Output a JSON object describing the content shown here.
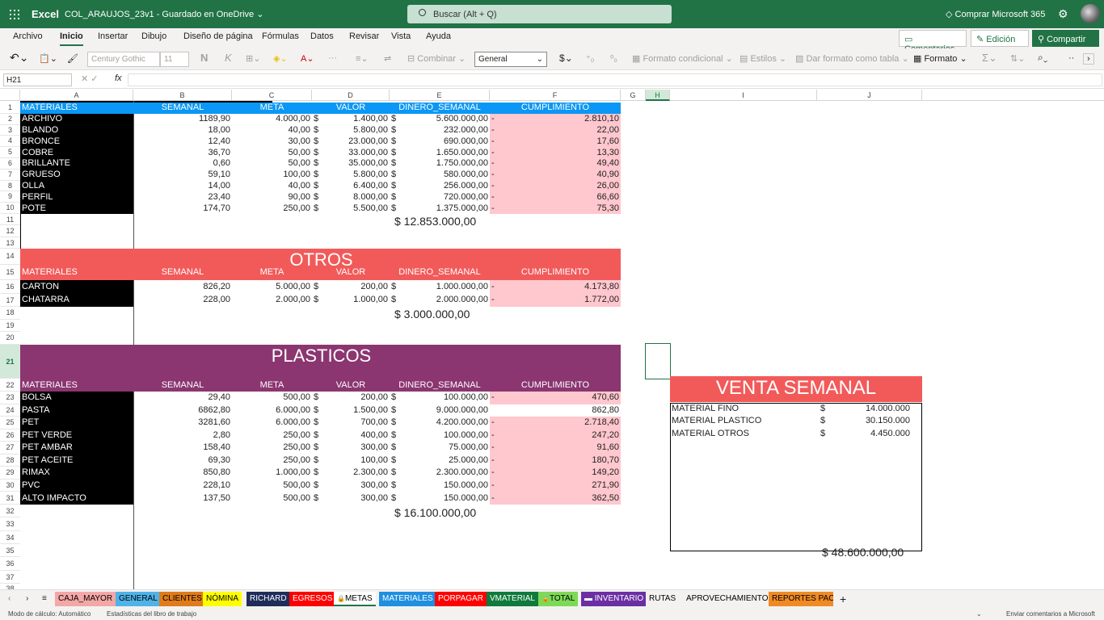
{
  "titlebar": {
    "app": "Excel",
    "doc": "COL_ARAUJOS_23v1 - Guardado en OneDrive ⌄",
    "search": "Buscar (Alt + Q)",
    "buy": "Comprar Microsoft 365",
    "gear": "⚙"
  },
  "menu": [
    "Archivo",
    "Inicio",
    "Insertar",
    "Dibujo",
    "Diseño de página",
    "Fórmulas",
    "Datos",
    "Revisar",
    "Vista",
    "Ayuda"
  ],
  "buttons": {
    "comments": "Comentarios",
    "edit": "Edición",
    "share": "Compartir"
  },
  "ribbon": {
    "font": "Century Gothic",
    "size": "11",
    "bold": "N",
    "italic": "K",
    "combine": "Combinar",
    "format": "General",
    "currency": "$",
    "cond": "Formato condicional",
    "styles": "Estilos",
    "table": "Dar formato como tabla",
    "fmt": "Formato"
  },
  "formula_bar": {
    "namebox": "H21",
    "fx": "fx"
  },
  "columns": [
    "A",
    "B",
    "C",
    "D",
    "E",
    "F",
    "G",
    "H",
    "I",
    "J"
  ],
  "rows": [
    "1",
    "2",
    "3",
    "4",
    "5",
    "6",
    "7",
    "8",
    "9",
    "10",
    "11",
    "12",
    "13",
    "14",
    "15",
    "16",
    "17",
    "18",
    "19",
    "20",
    "21",
    "22",
    "23",
    "24",
    "25",
    "26",
    "27",
    "28",
    "29",
    "30",
    "31",
    "32",
    "33",
    "34",
    "35",
    "36",
    "37",
    "38"
  ],
  "headers": {
    "a": "MATERIALES",
    "b": "SEMANAL",
    "c": "META",
    "d": "VALOR",
    "e": "DINERO_SEMANAL",
    "f": "CUMPLIMIENTO"
  },
  "section1": {
    "rows": [
      {
        "name": "ARCHIVO",
        "sem": "1189,90",
        "meta": "4.000,00",
        "valor": "1.400,00",
        "dinero": "5.600.000,00",
        "cump": "2.810,10"
      },
      {
        "name": "BLANDO",
        "sem": "18,00",
        "meta": "40,00",
        "valor": "5.800,00",
        "dinero": "232.000,00",
        "cump": "22,00"
      },
      {
        "name": "BRONCE",
        "sem": "12,40",
        "meta": "30,00",
        "valor": "23.000,00",
        "dinero": "690.000,00",
        "cump": "17,60"
      },
      {
        "name": "COBRE",
        "sem": "36,70",
        "meta": "50,00",
        "valor": "33.000,00",
        "dinero": "1.650.000,00",
        "cump": "13,30"
      },
      {
        "name": "BRILLANTE",
        "sem": "0,60",
        "meta": "50,00",
        "valor": "35.000,00",
        "dinero": "1.750.000,00",
        "cump": "49,40"
      },
      {
        "name": "GRUESO",
        "sem": "59,10",
        "meta": "100,00",
        "valor": "5.800,00",
        "dinero": "580.000,00",
        "cump": "40,90"
      },
      {
        "name": "OLLA",
        "sem": "14,00",
        "meta": "40,00",
        "valor": "6.400,00",
        "dinero": "256.000,00",
        "cump": "26,00"
      },
      {
        "name": "PERFIL",
        "sem": "23,40",
        "meta": "90,00",
        "valor": "8.000,00",
        "dinero": "720.000,00",
        "cump": "66,60"
      },
      {
        "name": "POTE",
        "sem": "174,70",
        "meta": "250,00",
        "valor": "5.500,00",
        "dinero": "1.375.000,00",
        "cump": "75,30"
      }
    ],
    "total": "$ 12.853.000,00"
  },
  "section2": {
    "title": "OTROS",
    "rows": [
      {
        "name": "CARTON",
        "sem": "826,20",
        "meta": "5.000,00",
        "valor": "200,00",
        "dinero": "1.000.000,00",
        "cump": "4.173,80"
      },
      {
        "name": "CHATARRA",
        "sem": "228,00",
        "meta": "2.000,00",
        "valor": "1.000,00",
        "dinero": "2.000.000,00",
        "cump": "1.772,00"
      }
    ],
    "total": "$  3.000.000,00"
  },
  "section3": {
    "title": "PLASTICOS",
    "rows": [
      {
        "name": "BOLSA",
        "sem": "29,40",
        "meta": "500,00",
        "valor": "200,00",
        "dinero": "100.000,00",
        "cump": "470,60",
        "neg": true
      },
      {
        "name": "PASTA",
        "sem": "6862,80",
        "meta": "6.000,00",
        "valor": "1.500,00",
        "dinero": "9.000.000,00",
        "cump": "862,80",
        "neg": false
      },
      {
        "name": "PET",
        "sem": "3281,60",
        "meta": "6.000,00",
        "valor": "700,00",
        "dinero": "4.200.000,00",
        "cump": "2.718,40",
        "neg": true
      },
      {
        "name": "PET VERDE",
        "sem": "2,80",
        "meta": "250,00",
        "valor": "400,00",
        "dinero": "100.000,00",
        "cump": "247,20",
        "neg": true
      },
      {
        "name": "PET AMBAR",
        "sem": "158,40",
        "meta": "250,00",
        "valor": "300,00",
        "dinero": "75.000,00",
        "cump": "91,60",
        "neg": true
      },
      {
        "name": "PET ACEITE",
        "sem": "69,30",
        "meta": "250,00",
        "valor": "100,00",
        "dinero": "25.000,00",
        "cump": "180,70",
        "neg": true
      },
      {
        "name": "RIMAX",
        "sem": "850,80",
        "meta": "1.000,00",
        "valor": "2.300,00",
        "dinero": "2.300.000,00",
        "cump": "149,20",
        "neg": true
      },
      {
        "name": "PVC",
        "sem": "228,10",
        "meta": "500,00",
        "valor": "300,00",
        "dinero": "150.000,00",
        "cump": "271,90",
        "neg": true
      },
      {
        "name": "ALTO IMPACTO",
        "sem": "137,50",
        "meta": "500,00",
        "valor": "300,00",
        "dinero": "150.000,00",
        "cump": "362,50",
        "neg": true
      }
    ],
    "total": "$ 16.100.000,00"
  },
  "venta": {
    "title": "VENTA SEMANAL",
    "rows": [
      {
        "label": "MATERIAL FINO",
        "val": "14.000.000"
      },
      {
        "label": "MATERIAL PLASTICO",
        "val": "30.150.000"
      },
      {
        "label": "MATERIAL OTROS",
        "val": "4.450.000"
      }
    ],
    "total": "$   48.600.000,00"
  },
  "sheets": [
    {
      "label": "CAJA_MAYOR",
      "bg": "#f4a7a7",
      "fg": "#000"
    },
    {
      "label": "GENERAL",
      "bg": "#4fb3e8",
      "fg": "#000"
    },
    {
      "label": "CLIENTES",
      "bg": "#e07b1a",
      "fg": "#000"
    },
    {
      "label": "NÓMINA",
      "bg": "#ffff00",
      "fg": "#000"
    },
    {
      "label": "RICHARD",
      "bg": "#1f2d5a",
      "fg": "#fff"
    },
    {
      "label": "EGRESOS",
      "bg": "#ff0000",
      "fg": "#fff"
    },
    {
      "label": "METAS",
      "bg": "#ffffff",
      "fg": "#000"
    },
    {
      "label": "MATERIALES",
      "bg": "#1f8fe0",
      "fg": "#fff"
    },
    {
      "label": "PORPAGAR",
      "bg": "#ff0000",
      "fg": "#fff"
    },
    {
      "label": "VMATERIAL",
      "bg": "#0f7a3c",
      "fg": "#fff"
    },
    {
      "label": "TOTAL",
      "bg": "#7ed957",
      "fg": "#000"
    },
    {
      "label": "INVENTARIO",
      "bg": "#6b2fa3",
      "fg": "#fff"
    },
    {
      "label": "RUTAS",
      "bg": "#f3f2f1",
      "fg": "#000"
    },
    {
      "label": "APROVECHAMIENTO",
      "bg": "#f3f2f1",
      "fg": "#000"
    },
    {
      "label": "REPORTES PACA",
      "bg": "#f08a24",
      "fg": "#000"
    }
  ],
  "status": {
    "calc": "Modo de cálculo: Automático",
    "stats": "Estadísticas del libro de trabajo",
    "feedback": "Enviar comentarios a Microsoft"
  },
  "colors": {
    "blue": "#0b97f5",
    "red": "#f25a5a",
    "purple": "#8b3670",
    "pink": "#ffc7ce",
    "green": "#217346"
  }
}
